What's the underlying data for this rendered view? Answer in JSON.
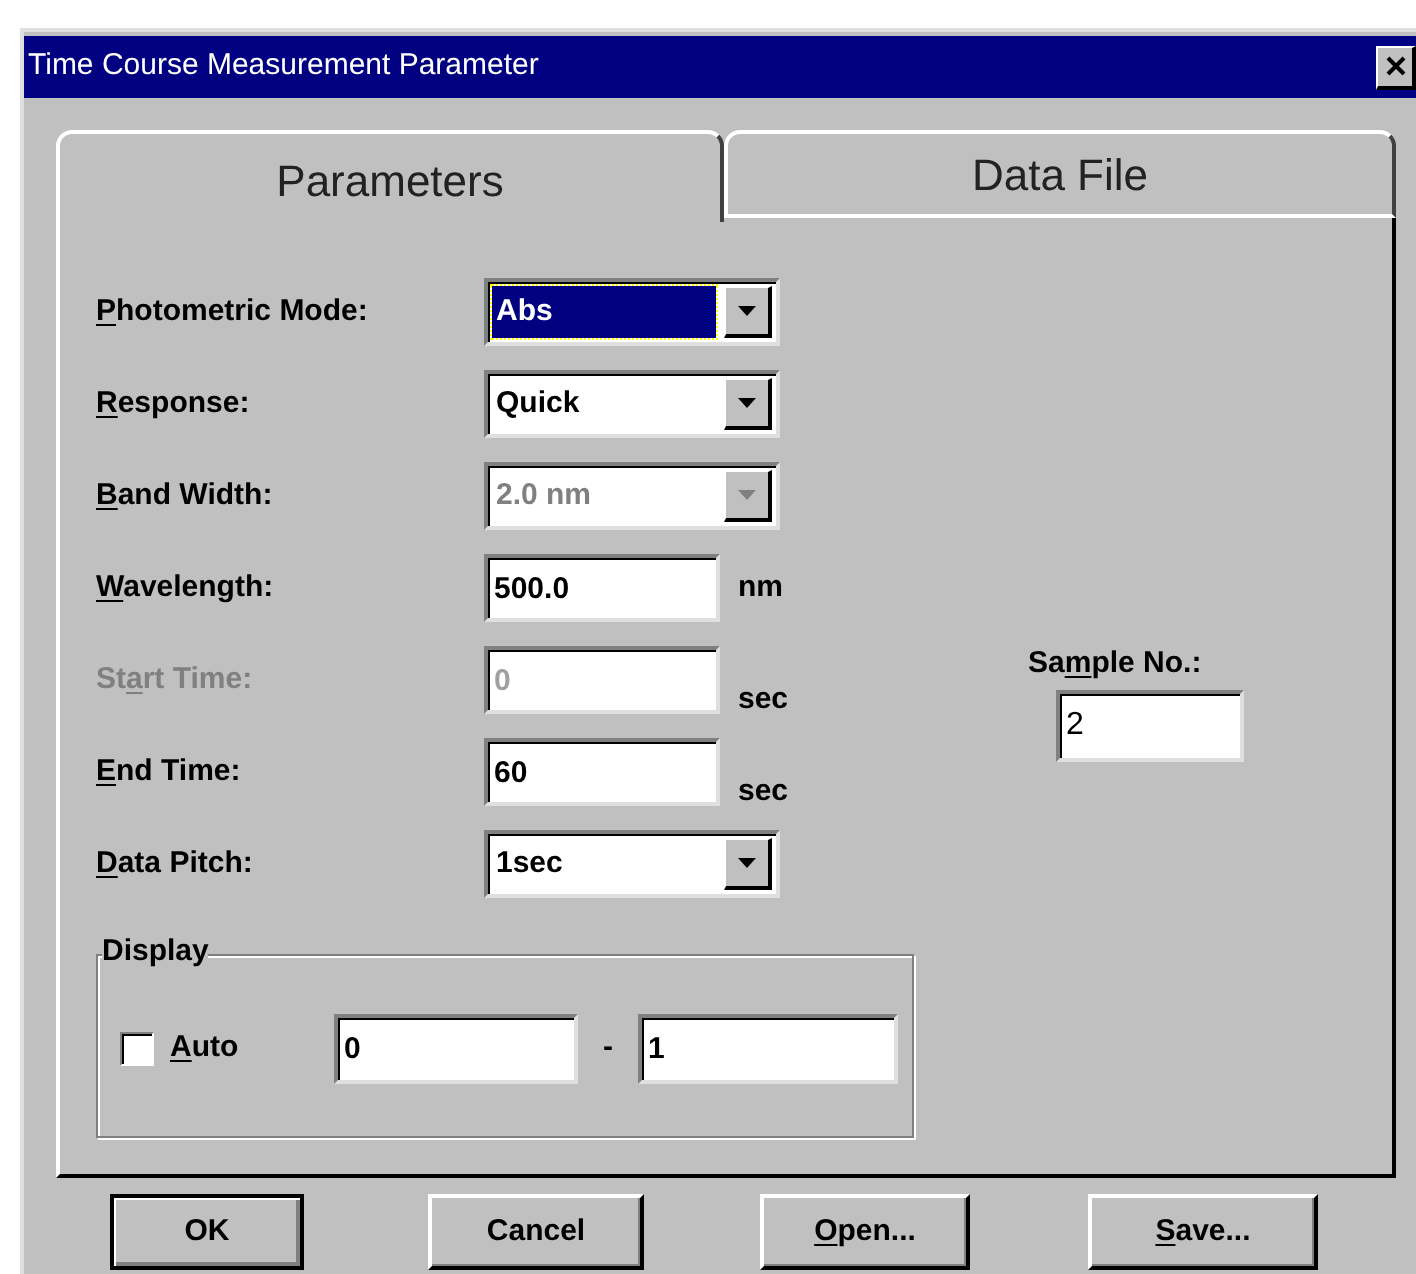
{
  "window": {
    "title": "Time Course Measurement Parameter"
  },
  "tabs": [
    {
      "label": "Parameters",
      "selected": true
    },
    {
      "label": "Data File",
      "selected": false
    }
  ],
  "fields": [
    {
      "kind": "combo",
      "label": {
        "key": "P",
        "after": "hotometric Mode:"
      },
      "value": "Abs",
      "focused": true,
      "disabled": false
    },
    {
      "kind": "combo",
      "label": {
        "key": "R",
        "after": "esponse:"
      },
      "value": "Quick",
      "focused": false,
      "disabled": false
    },
    {
      "kind": "combo",
      "label": {
        "key": "B",
        "after": "and Width:"
      },
      "value": "2.0 nm",
      "focused": false,
      "disabled": true
    },
    {
      "kind": "text",
      "label": {
        "key": "W",
        "after": "avelength:"
      },
      "value": "500.0",
      "unit": "nm",
      "focused": false,
      "disabled": false
    },
    {
      "kind": "text",
      "label": {
        "before": "St",
        "key": "a",
        "after": "rt Time:"
      },
      "value": "0",
      "unit": "sec",
      "focused": false,
      "disabled": true
    },
    {
      "kind": "text",
      "label": {
        "key": "E",
        "after": "nd Time:"
      },
      "value": "60",
      "unit": "sec",
      "focused": false,
      "disabled": false
    },
    {
      "kind": "combo",
      "label": {
        "key": "D",
        "after": "ata Pitch:"
      },
      "value": "1sec",
      "focused": false,
      "disabled": false
    }
  ],
  "display": {
    "title": "Display",
    "auto": {
      "label": {
        "key": "A",
        "after": "uto"
      },
      "checked": false
    },
    "from": "0",
    "separator": "-",
    "to": "1"
  },
  "sample": {
    "label": {
      "before": "Sa",
      "key": "m",
      "after": "ple No.:"
    },
    "value": "2"
  },
  "buttons": [
    {
      "label": {
        "after": "OK"
      },
      "default": true
    },
    {
      "label": {
        "after": "Cancel"
      },
      "default": false
    },
    {
      "label": {
        "key": "O",
        "after": "pen..."
      },
      "default": false
    },
    {
      "label": {
        "key": "S",
        "after": "ave..."
      },
      "default": false
    }
  ]
}
